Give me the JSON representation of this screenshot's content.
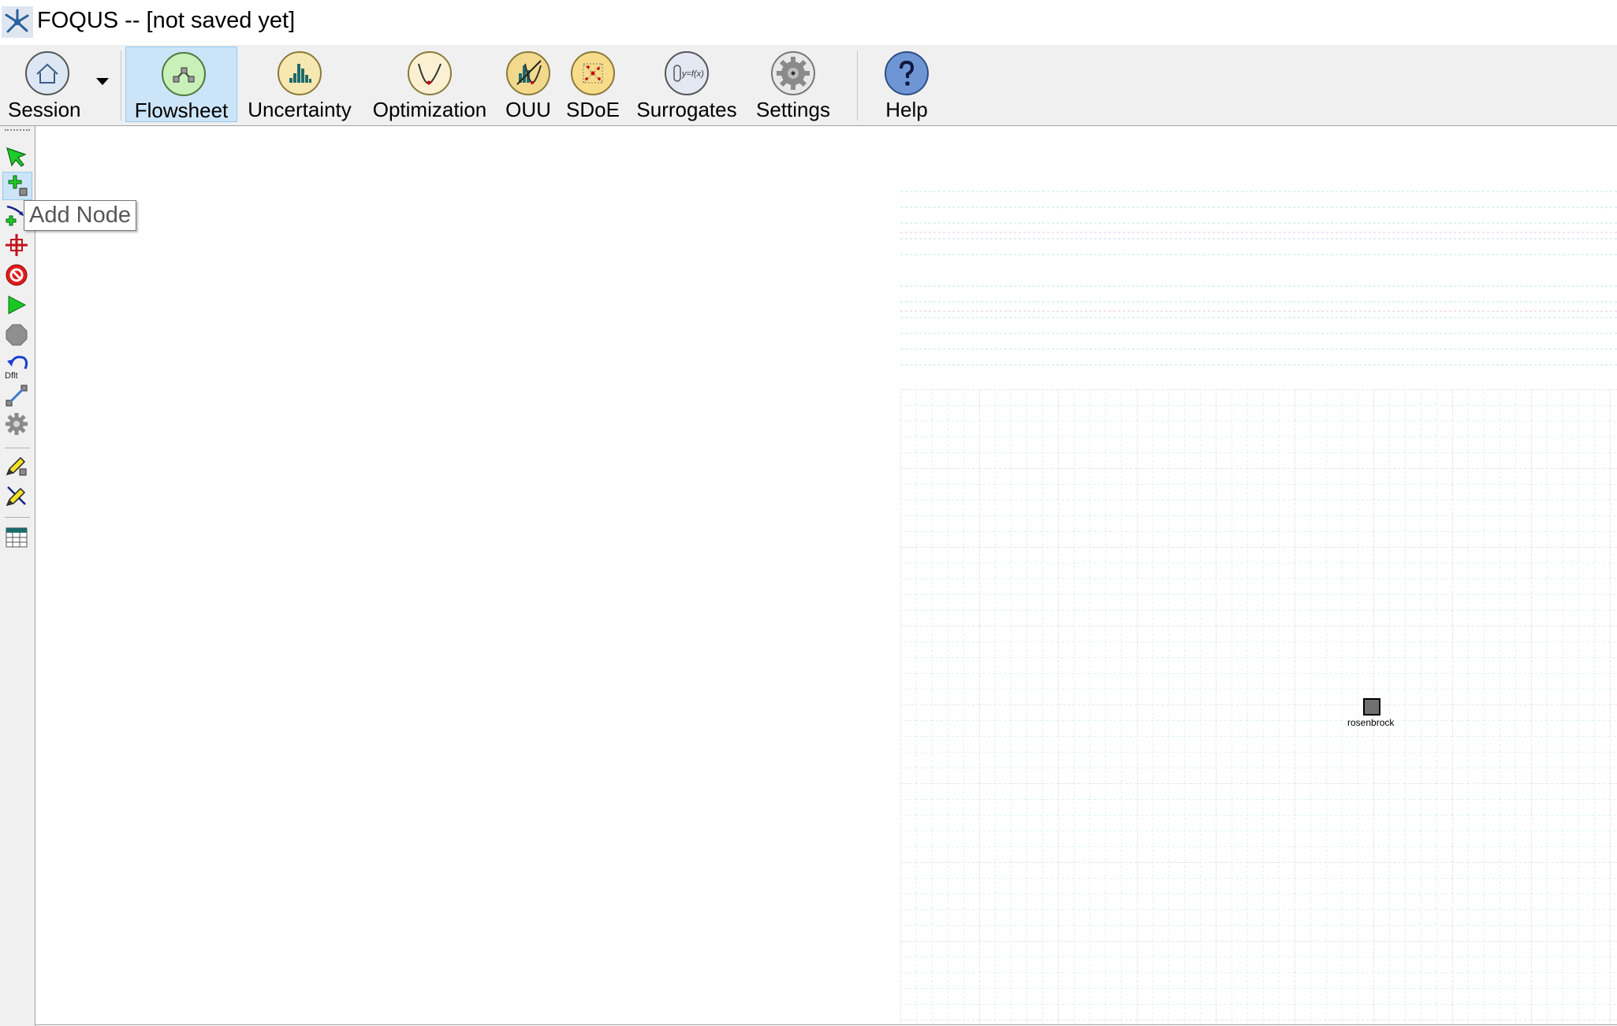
{
  "window": {
    "title": "FOQUS -- [not saved yet]"
  },
  "ribbon": {
    "items": [
      {
        "label": "Session",
        "icon": "home-icon"
      },
      {
        "label": "Flowsheet",
        "icon": "flowsheet-icon",
        "active": true
      },
      {
        "label": "Uncertainty",
        "icon": "histogram-icon"
      },
      {
        "label": "Optimization",
        "icon": "optimization-curve-icon"
      },
      {
        "label": "OUU",
        "icon": "ouu-icon"
      },
      {
        "label": "SDoE",
        "icon": "sdoe-icon"
      },
      {
        "label": "Surrogates",
        "icon": "surrogates-icon",
        "icon_text": "y=f(x)"
      },
      {
        "label": "Settings",
        "icon": "gear-icon"
      },
      {
        "label": "Help",
        "icon": "help-icon"
      }
    ]
  },
  "left_tools": [
    {
      "name": "select-tool",
      "icon": "select-arrow-icon"
    },
    {
      "name": "add-node-tool",
      "icon": "add-node-icon",
      "hovered": true
    },
    {
      "name": "add-edge-tool",
      "icon": "add-edge-icon"
    },
    {
      "name": "center-tool",
      "icon": "crosshair-icon"
    },
    {
      "name": "delete-tool",
      "icon": "no-sign-icon"
    },
    {
      "name": "run-tool",
      "icon": "play-icon"
    },
    {
      "name": "stop-tool",
      "icon": "stop-icon"
    },
    {
      "name": "reset-defaults-tool",
      "icon": "undo-default-icon",
      "icon_text": "Dflt"
    },
    {
      "name": "connect-tool",
      "icon": "connect-icon"
    },
    {
      "name": "settings-tool",
      "icon": "gear-icon"
    },
    {
      "name": "edit-node-tool",
      "icon": "pencil-icon"
    },
    {
      "name": "edit-edge-tool",
      "icon": "pencil-x-icon"
    },
    {
      "name": "table-tool",
      "icon": "table-icon"
    }
  ],
  "tooltip": {
    "text": "Add Node"
  },
  "canvas": {
    "nodes": [
      {
        "label": "rosenbrock"
      }
    ]
  },
  "colors": {
    "ribbon_bg": "#f0f0f0",
    "active_bg": "#cce4f7",
    "grid_minor": "#b8e4ea",
    "grid_major": "#e6b8e0",
    "node_fill": "#707070"
  }
}
